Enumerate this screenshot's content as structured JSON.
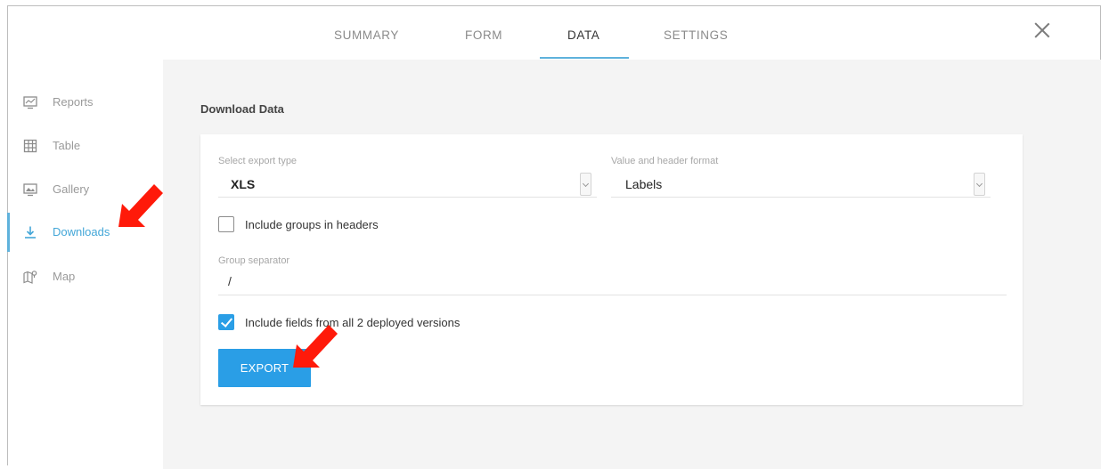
{
  "tabs": [
    {
      "label": "SUMMARY"
    },
    {
      "label": "FORM"
    },
    {
      "label": "DATA"
    },
    {
      "label": "SETTINGS"
    }
  ],
  "active_tab": "DATA",
  "sidebar": {
    "items": [
      {
        "label": "Reports",
        "icon": "reports-icon"
      },
      {
        "label": "Table",
        "icon": "table-icon"
      },
      {
        "label": "Gallery",
        "icon": "gallery-icon"
      },
      {
        "label": "Downloads",
        "icon": "download-icon"
      },
      {
        "label": "Map",
        "icon": "map-icon"
      }
    ],
    "active_item": "Downloads"
  },
  "main": {
    "title": "Download Data",
    "export_type": {
      "label": "Select export type",
      "value": "XLS"
    },
    "header_format": {
      "label": "Value and header format",
      "value": "Labels"
    },
    "include_groups": {
      "label": "Include groups in headers",
      "checked": false
    },
    "group_separator": {
      "label": "Group separator",
      "value": "/"
    },
    "include_versions": {
      "label": "Include fields from all 2 deployed versions",
      "checked": true
    },
    "export_button": "EXPORT"
  },
  "colors": {
    "accent": "#2a9ee6",
    "tab_underline": "#5fb2dc",
    "annotation_arrow": "#ff1a0a",
    "panel_background": "#f4f4f4"
  }
}
